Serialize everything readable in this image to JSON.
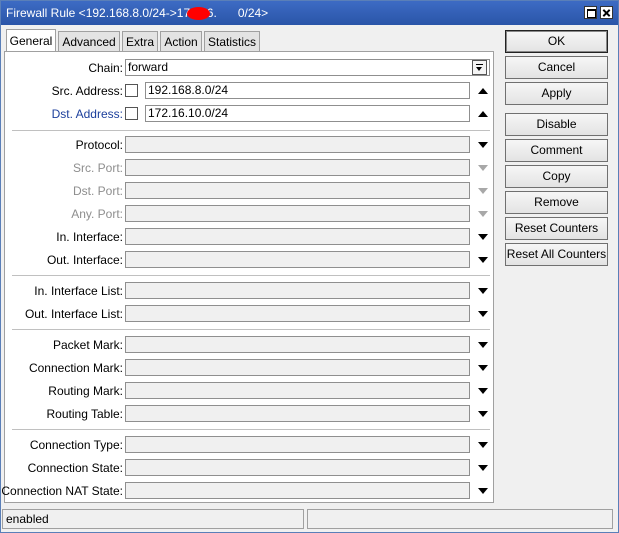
{
  "window": {
    "title": "Firewall Rule <192.168.8.0/24->172.16.",
    "title_tail": "0/24>"
  },
  "tabs": [
    {
      "label": "General",
      "active": true
    },
    {
      "label": "Advanced"
    },
    {
      "label": "Extra"
    },
    {
      "label": "Action"
    },
    {
      "label": "Statistics"
    }
  ],
  "general": {
    "chain": {
      "label": "Chain:",
      "value": "forward"
    },
    "src_address": {
      "label": "Src. Address:",
      "value": "192.168.8.0/24"
    },
    "dst_address": {
      "label": "Dst. Address:",
      "value": "172.16.10.0/24"
    },
    "protocol": {
      "label": "Protocol:",
      "value": ""
    },
    "src_port": {
      "label": "Src. Port:",
      "value": ""
    },
    "dst_port": {
      "label": "Dst. Port:",
      "value": ""
    },
    "any_port": {
      "label": "Any. Port:",
      "value": ""
    },
    "in_interface": {
      "label": "In. Interface:",
      "value": ""
    },
    "out_interface": {
      "label": "Out. Interface:",
      "value": ""
    },
    "in_interface_list": {
      "label": "In. Interface List:",
      "value": ""
    },
    "out_interface_list": {
      "label": "Out. Interface List:",
      "value": ""
    },
    "packet_mark": {
      "label": "Packet Mark:",
      "value": ""
    },
    "connection_mark": {
      "label": "Connection Mark:",
      "value": ""
    },
    "routing_mark": {
      "label": "Routing Mark:",
      "value": ""
    },
    "routing_table": {
      "label": "Routing Table:",
      "value": ""
    },
    "connection_type": {
      "label": "Connection Type:",
      "value": ""
    },
    "connection_state": {
      "label": "Connection State:",
      "value": ""
    },
    "connection_nat_state": {
      "label": "Connection NAT State:",
      "value": ""
    }
  },
  "buttons": {
    "ok": "OK",
    "cancel": "Cancel",
    "apply": "Apply",
    "disable": "Disable",
    "comment": "Comment",
    "copy": "Copy",
    "remove": "Remove",
    "reset_counters": "Reset Counters",
    "reset_all_counters": "Reset All Counters"
  },
  "status": {
    "left": "enabled",
    "right": ""
  }
}
